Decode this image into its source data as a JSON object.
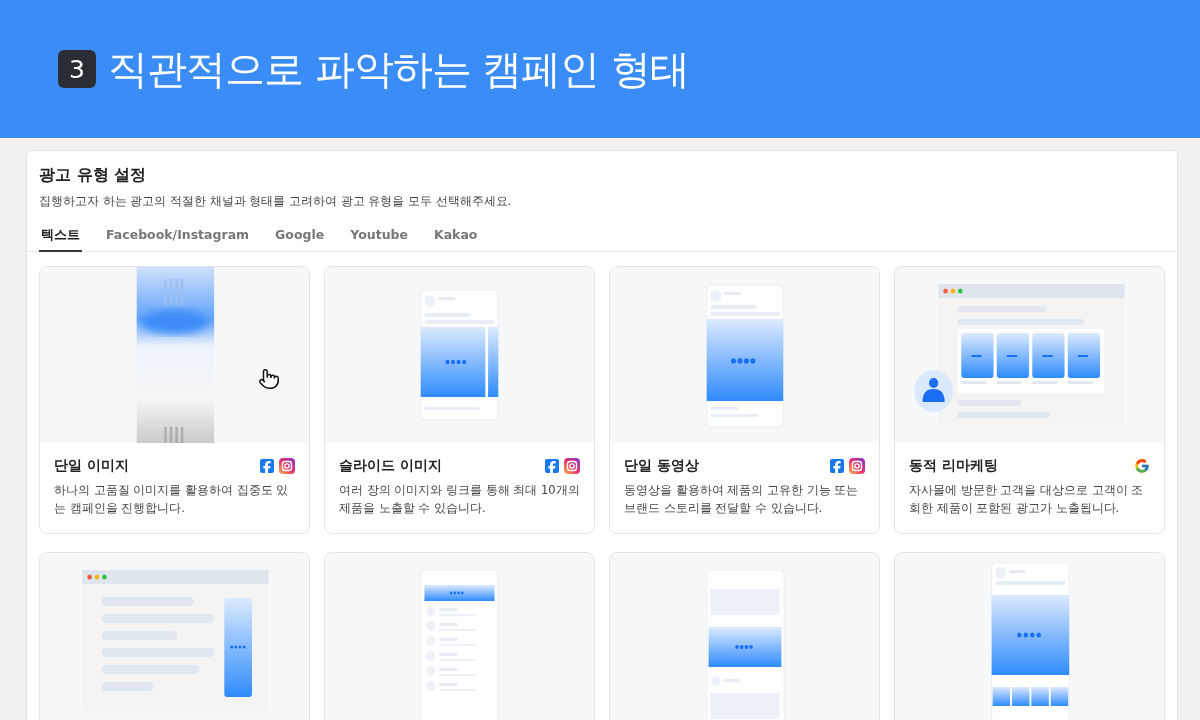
{
  "banner": {
    "step": "3",
    "title": "직관적으로 파악하는 캠페인 형태"
  },
  "panel": {
    "title": "광고 유형 설정",
    "description": "집행하고자 하는 광고의 적절한 채널과 형태를 고려하여 광고 유형을 모두 선택해주세요."
  },
  "tabs": [
    {
      "label": "텍스트",
      "selected": true
    },
    {
      "label": "Facebook/Instagram",
      "selected": false
    },
    {
      "label": "Google",
      "selected": false
    },
    {
      "label": "Youtube",
      "selected": false
    },
    {
      "label": "Kakao",
      "selected": false
    }
  ],
  "cards": [
    {
      "kind": "blurred",
      "badges": [
        {
          "kind": "facebook"
        },
        {
          "kind": "instagram"
        }
      ],
      "title": "단일 이미지",
      "description": "하나의 고품질 이미지를 활용하여 집중도 있는 캠페인을 진행합니다."
    },
    {
      "kind": "carousel",
      "badges": [
        {
          "kind": "facebook"
        },
        {
          "kind": "instagram"
        }
      ],
      "title": "슬라이드 이미지",
      "description": "여러 장의 이미지와 링크를 통해 최대 10개의 제품을 노출할 수 있습니다."
    },
    {
      "kind": "video",
      "badges": [
        {
          "kind": "facebook"
        },
        {
          "kind": "instagram"
        }
      ],
      "title": "단일 동영상",
      "description": "동영상을 활용하여 제품의 고유한 기능 또는 브랜드 스토리를 전달할 수 있습니다."
    },
    {
      "kind": "remarketing",
      "badges": [
        {
          "kind": "google"
        }
      ],
      "title": "동적 리마케팅",
      "description": "자사몰에 방문한 고객을 대상으로 고객이 조회한 제품이 포함된 광고가 노출됩니다."
    },
    {
      "kind": "banner"
    },
    {
      "kind": "list"
    },
    {
      "kind": "feed"
    },
    {
      "kind": "collection"
    }
  ]
}
